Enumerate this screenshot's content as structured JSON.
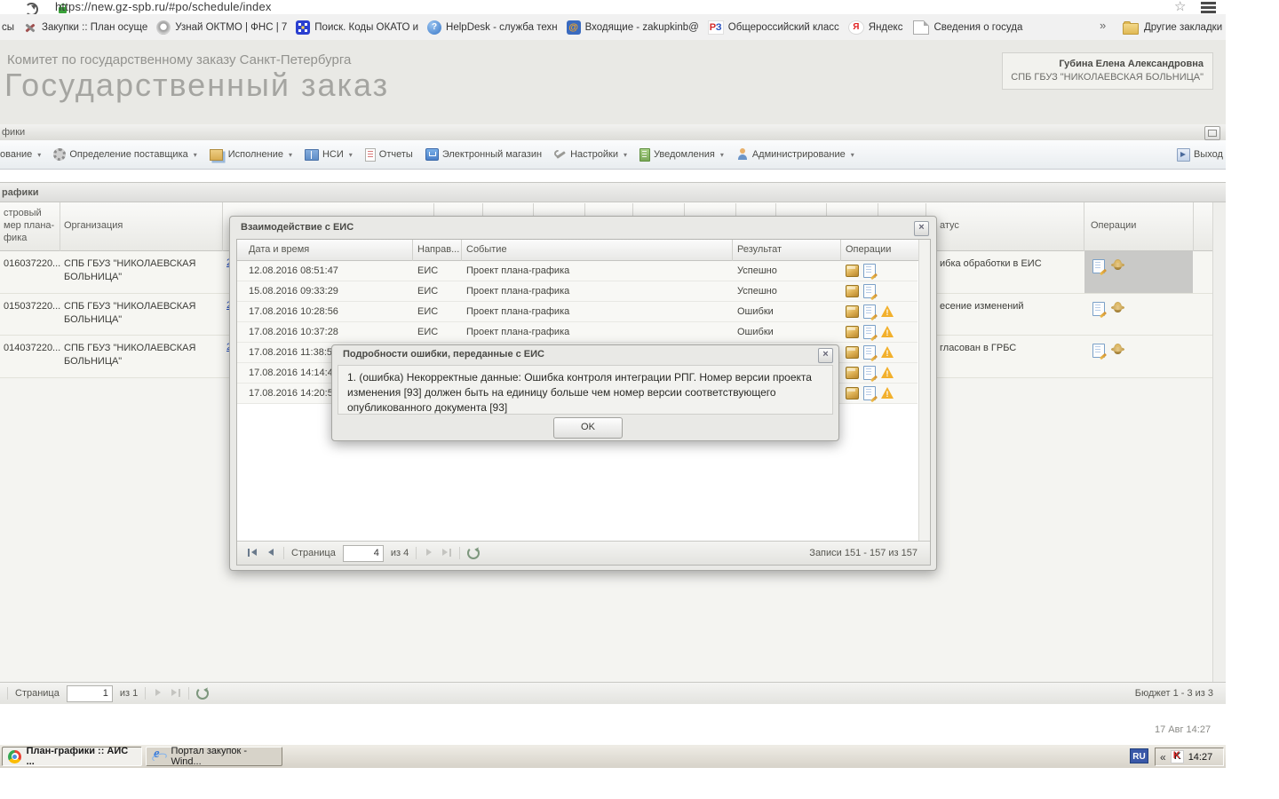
{
  "icons": {
    "lock-icon": "green padlock",
    "reload-icon": "circular arrow",
    "star-icon": "bookmark star outline",
    "menu-icon": "hamburger bars",
    "package-icon": "gold box",
    "doc-edit-icon": "page with pencil",
    "warning-icon": "amber triangle with exclamation",
    "emblem-icon": "gold double-eagle crest",
    "refresh-icon": "green circular arrow"
  },
  "browser": {
    "url": "https://new.gz-spb.ru/#po/schedule/index",
    "bookmarks_bar": {
      "partial_left": "сы",
      "items": [
        "Закупки :: План осуще",
        "Узнай ОКТМО | ФНС | 7",
        "Поиск. Коды ОКАТО и",
        "HelpDesk - служба техн",
        "Входящие - zakupkinb@",
        "Общероссийский класс",
        "Яндекс",
        "Сведения о государст"
      ],
      "overflow_chevron": "»",
      "other_bookmarks": "Другие закладки"
    }
  },
  "app_header": {
    "committee": "Комитет по государственному заказу Санкт-Петербурга",
    "app_title": "Государственный заказ",
    "user_name": "Губина Елена Александровна",
    "user_org": "СПБ ГБУЗ \"НИКОЛАЕВСКАЯ БОЛЬНИЦА\""
  },
  "top_panel": {
    "title_partial": "фики"
  },
  "menu": {
    "items": [
      {
        "label": "ование"
      },
      {
        "label": "Определение поставщика"
      },
      {
        "label": "Исполнение"
      },
      {
        "label": "НСИ"
      },
      {
        "label": "Отчеты"
      },
      {
        "label": "Электронный магазин"
      },
      {
        "label": "Настройки"
      },
      {
        "label": "Уведомления"
      },
      {
        "label": "Администрирование"
      }
    ],
    "exit_label": "Выход"
  },
  "grid": {
    "panel_title_partial": "рафики",
    "columns": {
      "regnum_lines": [
        "стровый",
        "мер плана-",
        "фика"
      ],
      "org": "Организация",
      "status_partial": "атус",
      "operations": "Операции"
    },
    "rows": [
      {
        "regnum": "016037220...",
        "org": "СПБ ГБУЗ \"НИКОЛАЕВСКАЯ БОЛЬНИЦА\"",
        "link": "2",
        "status_partial": "ибка обработки в ЕИС"
      },
      {
        "regnum": "015037220...",
        "org": "СПБ ГБУЗ \"НИКОЛАЕВСКАЯ БОЛЬНИЦА\"",
        "link": "2",
        "status_partial": "есение изменений"
      },
      {
        "regnum": "014037220...",
        "org": "СПБ ГБУЗ \"НИКОЛАЕВСКАЯ БОЛЬНИЦА\"",
        "link": "2",
        "status_partial": "гласован в ГРБС"
      }
    ],
    "pager": {
      "page_label": "Страница",
      "page_value": "1",
      "page_of": "из 1",
      "right_info": "Бюджет 1 - 3 из 3"
    }
  },
  "eis_modal": {
    "title": "Взаимодействие с ЕИС",
    "columns": [
      "Дата и время",
      "Направ...",
      "Событие",
      "Результат",
      "Операции"
    ],
    "rows": [
      {
        "datetime": "12.08.2016 08:51:47",
        "direction": "ЕИС",
        "event": "Проект плана-графика",
        "result": "Успешно"
      },
      {
        "datetime": "15.08.2016 09:33:29",
        "direction": "ЕИС",
        "event": "Проект плана-графика",
        "result": "Успешно"
      },
      {
        "datetime": "17.08.2016 10:28:56",
        "direction": "ЕИС",
        "event": "Проект плана-графика",
        "result": "Ошибки"
      },
      {
        "datetime": "17.08.2016 10:37:28",
        "direction": "ЕИС",
        "event": "Проект плана-графика",
        "result": "Ошибки"
      },
      {
        "datetime": "17.08.2016 11:38:5",
        "direction": "",
        "event": "",
        "result": ""
      },
      {
        "datetime": "17.08.2016 14:14:4",
        "direction": "",
        "event": "",
        "result": ""
      },
      {
        "datetime": "17.08.2016 14:20:5",
        "direction": "",
        "event": "",
        "result": ""
      }
    ],
    "pager": {
      "page_label": "Страница",
      "page_value": "4",
      "page_of": "из 4",
      "right_info": "Записи 151 - 157 из 157"
    }
  },
  "error_modal": {
    "title": "Подробности ошибки, переданные с ЕИС",
    "message": "1. (ошибка) Некорректные данные: Ошибка контроля интеграции РПГ. Номер версии проекта изменения [93] должен быть на единицу больше чем номер версии соответствующего опубликованного документа [93]",
    "ok_label": "OK"
  },
  "status_bar": {
    "timestamp": "17 Авг 14:27"
  },
  "taskbar": {
    "buttons": [
      {
        "label": "План-графики :: АИС ..."
      },
      {
        "label": "Портал закупок - Wind..."
      }
    ],
    "tray": {
      "lang": "RU",
      "chevron": "«",
      "time": "14:27"
    }
  }
}
